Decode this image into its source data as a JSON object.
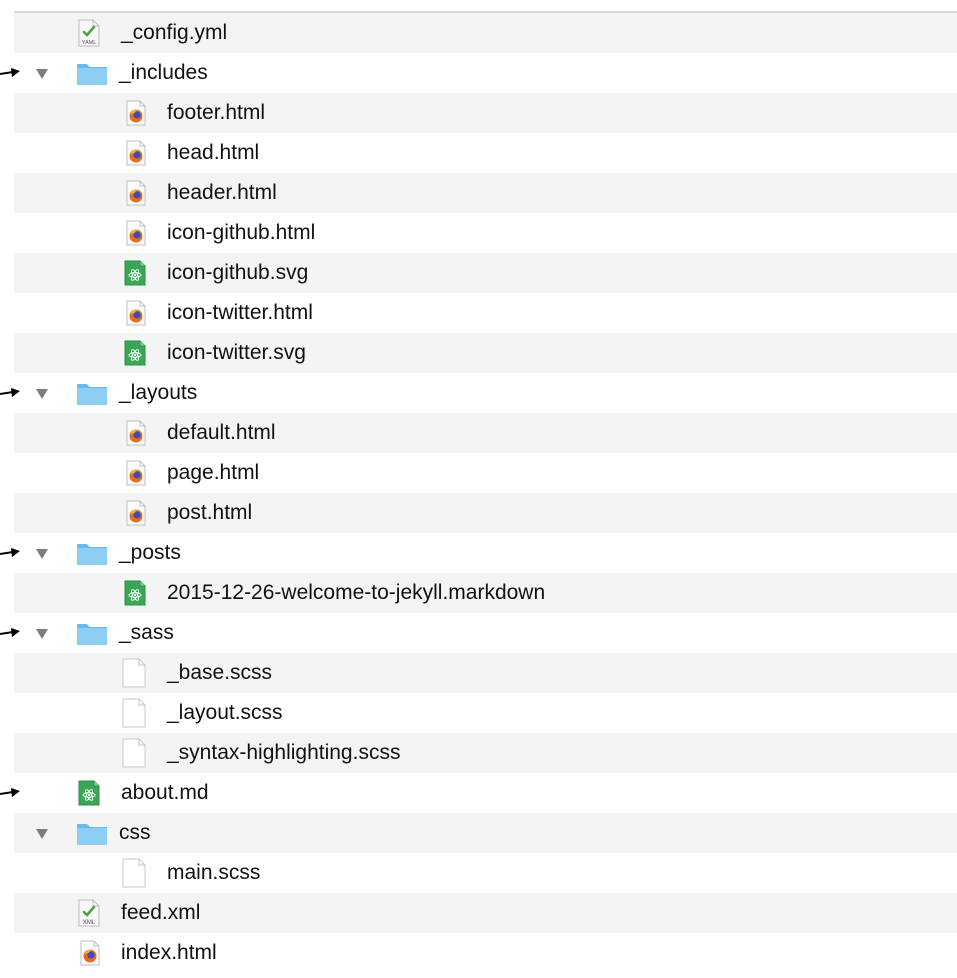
{
  "file_tree": [
    {
      "name": "_config.yml",
      "kind": "yaml",
      "icon_name": "yaml-file-icon",
      "depth": 1,
      "expanded": null,
      "alt": true,
      "marker": false
    },
    {
      "name": "_includes",
      "kind": "folder",
      "icon_name": "folder-icon",
      "depth": 1,
      "expanded": true,
      "alt": false,
      "marker": true
    },
    {
      "name": "footer.html",
      "kind": "html",
      "icon_name": "firefox-html-file-icon",
      "depth": 2,
      "expanded": null,
      "alt": true,
      "marker": false
    },
    {
      "name": "head.html",
      "kind": "html",
      "icon_name": "firefox-html-file-icon",
      "depth": 2,
      "expanded": null,
      "alt": false,
      "marker": false
    },
    {
      "name": "header.html",
      "kind": "html",
      "icon_name": "firefox-html-file-icon",
      "depth": 2,
      "expanded": null,
      "alt": true,
      "marker": false
    },
    {
      "name": "icon-github.html",
      "kind": "html",
      "icon_name": "firefox-html-file-icon",
      "depth": 2,
      "expanded": null,
      "alt": false,
      "marker": false
    },
    {
      "name": "icon-github.svg",
      "kind": "atom",
      "icon_name": "atom-file-icon",
      "depth": 2,
      "expanded": null,
      "alt": true,
      "marker": false
    },
    {
      "name": "icon-twitter.html",
      "kind": "html",
      "icon_name": "firefox-html-file-icon",
      "depth": 2,
      "expanded": null,
      "alt": false,
      "marker": false
    },
    {
      "name": "icon-twitter.svg",
      "kind": "atom",
      "icon_name": "atom-file-icon",
      "depth": 2,
      "expanded": null,
      "alt": true,
      "marker": false
    },
    {
      "name": "_layouts",
      "kind": "folder",
      "icon_name": "folder-icon",
      "depth": 1,
      "expanded": true,
      "alt": false,
      "marker": true
    },
    {
      "name": "default.html",
      "kind": "html",
      "icon_name": "firefox-html-file-icon",
      "depth": 2,
      "expanded": null,
      "alt": true,
      "marker": false
    },
    {
      "name": "page.html",
      "kind": "html",
      "icon_name": "firefox-html-file-icon",
      "depth": 2,
      "expanded": null,
      "alt": false,
      "marker": false
    },
    {
      "name": "post.html",
      "kind": "html",
      "icon_name": "firefox-html-file-icon",
      "depth": 2,
      "expanded": null,
      "alt": true,
      "marker": false
    },
    {
      "name": "_posts",
      "kind": "folder",
      "icon_name": "folder-icon",
      "depth": 1,
      "expanded": true,
      "alt": false,
      "marker": true
    },
    {
      "name": "2015-12-26-welcome-to-jekyll.markdown",
      "kind": "atom",
      "icon_name": "atom-file-icon",
      "depth": 2,
      "expanded": null,
      "alt": true,
      "marker": false
    },
    {
      "name": "_sass",
      "kind": "folder",
      "icon_name": "folder-icon",
      "depth": 1,
      "expanded": true,
      "alt": false,
      "marker": true
    },
    {
      "name": "_base.scss",
      "kind": "blank",
      "icon_name": "blank-file-icon",
      "depth": 2,
      "expanded": null,
      "alt": true,
      "marker": false
    },
    {
      "name": "_layout.scss",
      "kind": "blank",
      "icon_name": "blank-file-icon",
      "depth": 2,
      "expanded": null,
      "alt": false,
      "marker": false
    },
    {
      "name": "_syntax-highlighting.scss",
      "kind": "blank",
      "icon_name": "blank-file-icon",
      "depth": 2,
      "expanded": null,
      "alt": true,
      "marker": false
    },
    {
      "name": "about.md",
      "kind": "atom",
      "icon_name": "atom-file-icon",
      "depth": 1,
      "expanded": null,
      "alt": false,
      "marker": true
    },
    {
      "name": "css",
      "kind": "folder",
      "icon_name": "folder-icon",
      "depth": 1,
      "expanded": true,
      "alt": true,
      "marker": false
    },
    {
      "name": "main.scss",
      "kind": "blank",
      "icon_name": "blank-file-icon",
      "depth": 2,
      "expanded": null,
      "alt": false,
      "marker": false
    },
    {
      "name": "feed.xml",
      "kind": "xml",
      "icon_name": "xml-file-icon",
      "depth": 1,
      "expanded": null,
      "alt": true,
      "marker": false
    },
    {
      "name": "index.html",
      "kind": "html",
      "icon_name": "firefox-html-file-icon",
      "depth": 1,
      "expanded": null,
      "alt": false,
      "marker": false
    }
  ],
  "colors": {
    "row_alt": "#f4f4f4",
    "folder": "#7cc4ef",
    "triangle": "#7d7d7d",
    "atom_green": "#3aa655",
    "firefox_orange": "#e86a1f"
  }
}
